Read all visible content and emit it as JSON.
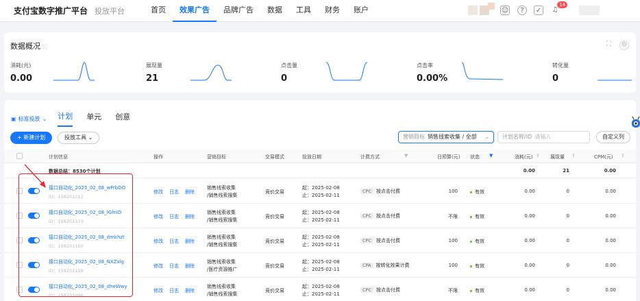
{
  "topnav": {
    "brand": "支付宝数字推广平台",
    "subbrand": "投放平台",
    "items": [
      "首页",
      "效果广告",
      "品牌广告",
      "数据",
      "工具",
      "财务",
      "账户"
    ],
    "active": "效果广告",
    "notification_count": "14"
  },
  "overview": {
    "title": "数据概况",
    "metrics": [
      {
        "label": "消耗(元)",
        "value": "0.00"
      },
      {
        "label": "展现量",
        "value": "21"
      },
      {
        "label": "点击量",
        "value": "0"
      },
      {
        "label": "点击率",
        "value": "0.00%"
      },
      {
        "label": "转化量",
        "value": "0"
      }
    ]
  },
  "toolbar": {
    "ad_type": "标准投放",
    "tabs": [
      "计划",
      "单元",
      "创意"
    ],
    "new_plan": "+ 新建计划",
    "tools": "投放工具",
    "filter_label": "营销目标",
    "filter_value": "销售线索收集 / 全部",
    "search_label": "计划名称/ID",
    "search_placeholder": "请输入",
    "custom_columns": "自定义列"
  },
  "table": {
    "headers": {
      "info": "计划信息",
      "ops": "操作",
      "goal": "营销目标",
      "trade": "交易模式",
      "date": "投放日期",
      "billing": "计费方式",
      "budget": "日预算(元)",
      "status": "状态",
      "cost": "消耗(元)",
      "impr": "展现量",
      "cpm": "CPM(元)"
    },
    "summary": {
      "label": "数据总结：8530个计划",
      "cost": "0.00",
      "impr": "21",
      "cpm": "0.00"
    },
    "op_labels": [
      "修改",
      "日志",
      "删除"
    ],
    "rows": [
      {
        "name": "接口自动化_2025_02_08_wFrbDO",
        "id": "ID：158201212",
        "goal1": "销售线索收集",
        "goal2": "/销售线索搜集",
        "trade": "竞价交易",
        "start": "起：2025-02-08",
        "end": "止：2025-02-11",
        "tag": "CPC",
        "billing": "按点击付费",
        "budget": "100",
        "status": "有效",
        "cost": "0.00",
        "impr": "0",
        "cpm": "0.00"
      },
      {
        "name": "接口自动化_2025_02_08_lGfnID",
        "id": "ID：158201173",
        "goal1": "销售线索收集",
        "goal2": "/销售线索搜集",
        "trade": "竞价交易",
        "start": "起：2025-02-08",
        "end": "止：2025-02-11",
        "tag": "CPC",
        "billing": "按点击付费",
        "budget": "不限",
        "status": "有效",
        "cost": "0.00",
        "impr": "0",
        "cpm": "0.00"
      },
      {
        "name": "接口自动化_2025_02_08_dmkhzt",
        "id": "ID：158201160",
        "goal1": "销售线索收集",
        "goal2": "/销售线索搜集",
        "trade": "竞价交易",
        "start": "起：2025-02-08",
        "end": "止：2025-02-11",
        "tag": "CPC",
        "billing": "按点击付费",
        "budget": "100",
        "status": "有效",
        "cost": "0.00",
        "impr": "0",
        "cpm": "0.00"
      },
      {
        "name": "接口自动化_2025_02_08_NXZxlg",
        "id": "ID：158201159",
        "goal1": "销售线索收集",
        "goal2": "/医疗资源推广",
        "trade": "竞价交易",
        "start": "起：2025-02-08",
        "end": "止：2025-02-11",
        "tag": "CPA",
        "billing": "按转化效果计费",
        "budget": "100",
        "status": "有效",
        "cost": "0.00",
        "impr": "0",
        "cpm": "0.00"
      },
      {
        "name": "接口自动化_2025_02_08_dheWwy",
        "id": "ID：158201096",
        "goal1": "销售线索收集",
        "goal2": "/销售线索搜集",
        "trade": "竞价交易",
        "start": "起：2025-02-08",
        "end": "止：2025-02-11",
        "tag": "CPC",
        "billing": "按点击付费",
        "budget": "不限",
        "status": "有效",
        "cost": "0.00",
        "impr": "0",
        "cpm": "0.00"
      }
    ]
  },
  "colors": {
    "accent": "#1677ff",
    "highlight": "#f5222d"
  }
}
